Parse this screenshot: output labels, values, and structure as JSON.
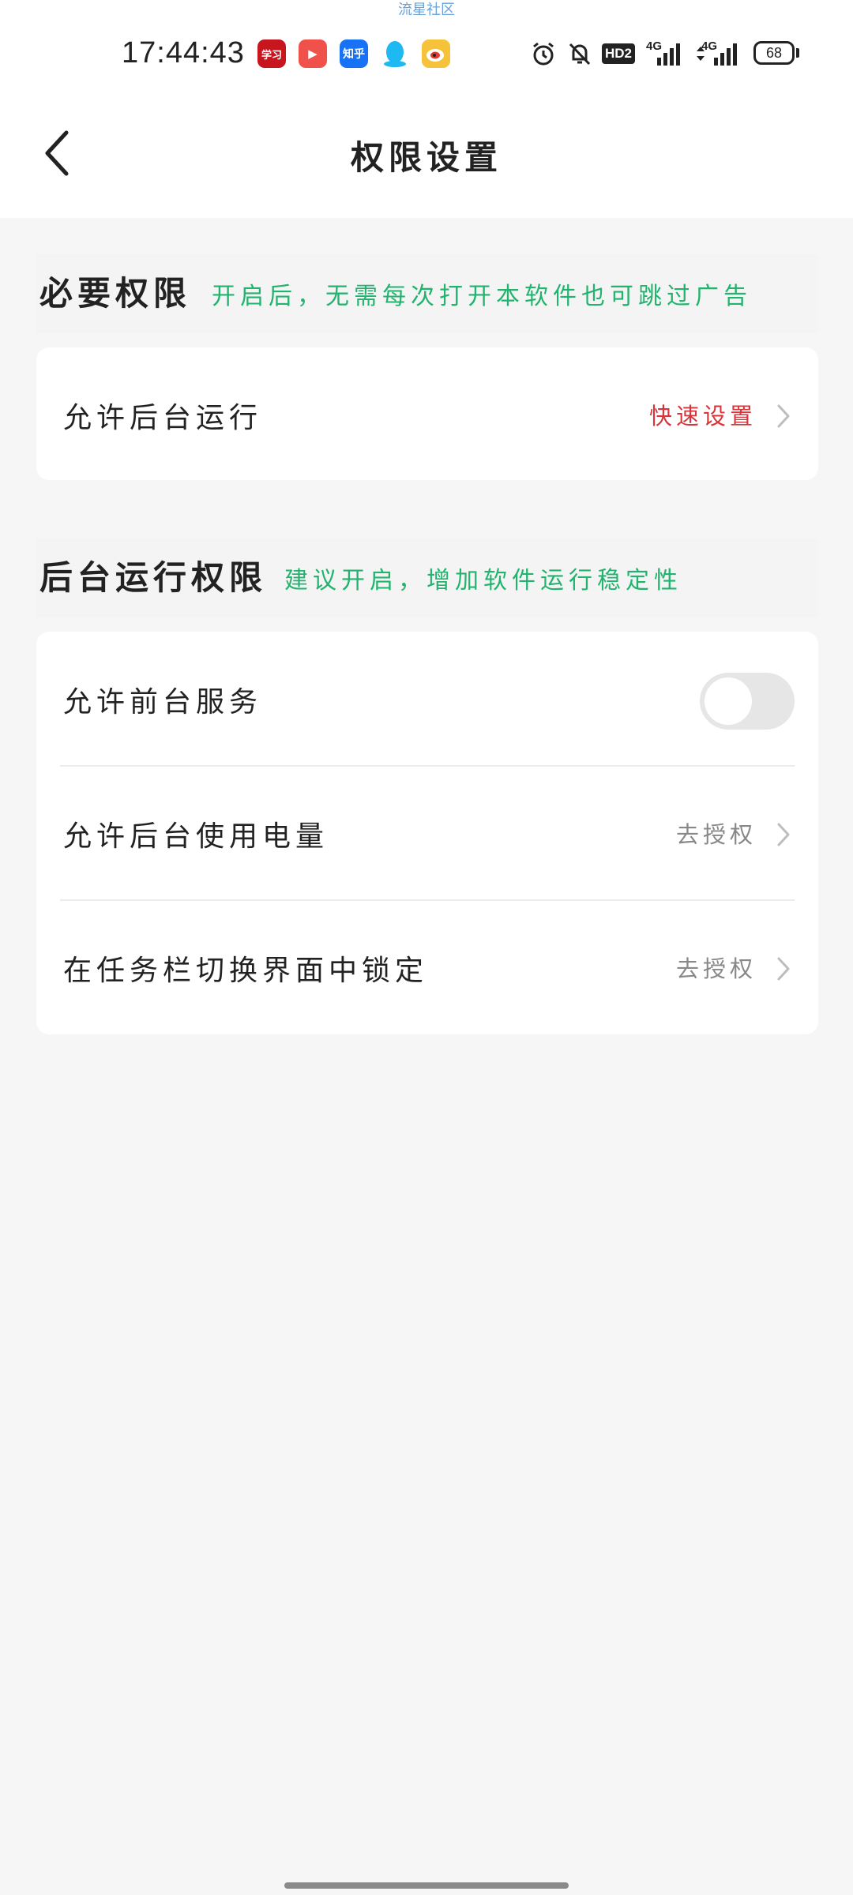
{
  "status_bar": {
    "watermark": "流星社区",
    "time": "17:44:43",
    "apps": [
      {
        "icon": "xuexi-app-icon",
        "label": "学习",
        "color": "#c8161e"
      },
      {
        "icon": "video-play-app-icon",
        "label": "▶",
        "color": "#f0524b"
      },
      {
        "icon": "zhihu-app-icon",
        "label": "知乎",
        "color": "#1772f6"
      },
      {
        "icon": "qq-penguin-app-icon",
        "label": "",
        "color": "#1eb8f2"
      },
      {
        "icon": "weibo-app-icon",
        "label": "",
        "color": "#f5c23a"
      }
    ],
    "hd_label": "HD2",
    "net1_label": "4G",
    "net2_label": "4G",
    "battery_level": "68"
  },
  "nav": {
    "title": "权限设置"
  },
  "sections": [
    {
      "title": "必要权限",
      "subtitle": "开启后，无需每次打开本软件也可跳过广告",
      "rows": [
        {
          "label": "允许后台运行",
          "action": "快速设置",
          "action_color": "#d9343a"
        }
      ]
    },
    {
      "title": "后台运行权限",
      "subtitle": "建议开启，增加软件运行稳定性",
      "rows": [
        {
          "label": "允许前台服务",
          "toggle": false
        },
        {
          "label": "允许后台使用电量",
          "action": "去授权",
          "action_color": "#888888"
        },
        {
          "label": "在任务栏切换界面中锁定",
          "action": "去授权",
          "action_color": "#888888"
        }
      ]
    }
  ],
  "colors": {
    "subtitle_green": "#22b36e",
    "accent_red": "#d9343a",
    "toggle_off": "#e6e6e6"
  }
}
